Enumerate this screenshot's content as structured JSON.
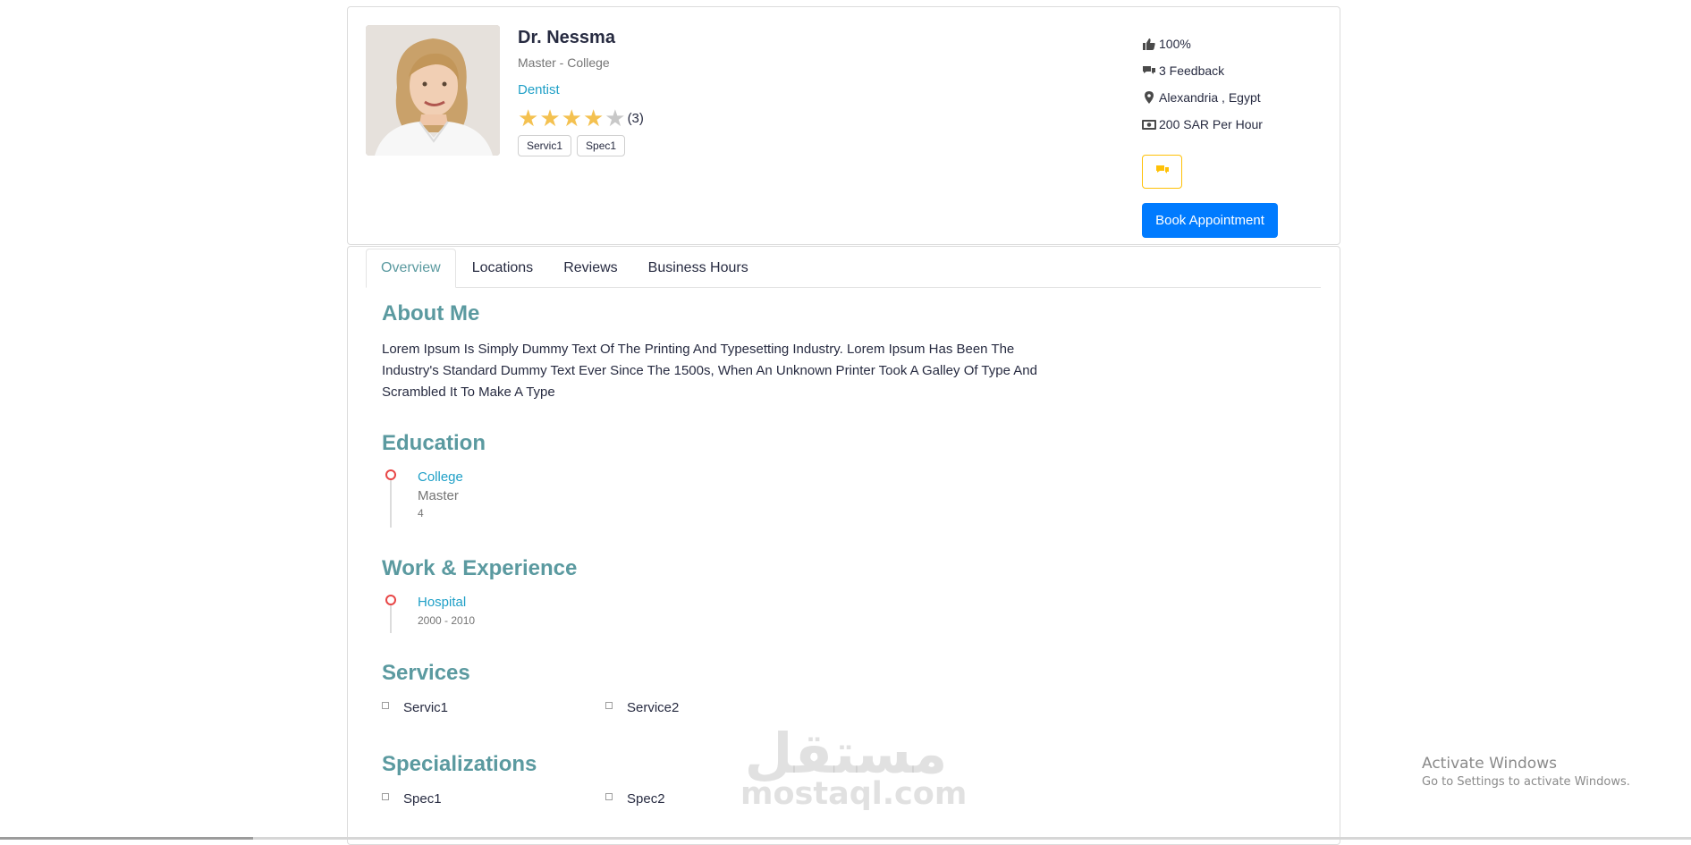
{
  "profile": {
    "name": "Dr. Nessma",
    "degree": "Master - College",
    "specialty": "Dentist",
    "rating": 4,
    "rating_max": 5,
    "rating_count": "(3)",
    "tags": [
      "Servic1",
      "Spec1"
    ]
  },
  "side": {
    "likes": "100%",
    "feedback": "3 Feedback",
    "location": "Alexandria , Egypt",
    "price": "200 SAR Per Hour",
    "book_label": "Book Appointment"
  },
  "tabs": [
    {
      "label": "Overview",
      "active": true
    },
    {
      "label": "Locations",
      "active": false
    },
    {
      "label": "Reviews",
      "active": false
    },
    {
      "label": "Business Hours",
      "active": false
    }
  ],
  "about": {
    "title": "About Me",
    "text": "Lorem Ipsum Is Simply Dummy Text Of The Printing And Typesetting Industry. Lorem Ipsum Has Been The Industry's Standard Dummy Text Ever Since The 1500s, When An Unknown Printer Took A Galley Of Type And Scrambled It To Make A Type"
  },
  "education": {
    "title": "Education",
    "items": [
      {
        "institution": "College",
        "degree": "Master",
        "years": "4"
      }
    ]
  },
  "experience": {
    "title": "Work & Experience",
    "items": [
      {
        "place": "Hospital",
        "period": "2000 - 2010"
      }
    ]
  },
  "services": {
    "title": "Services",
    "items": [
      "Servic1",
      "Service2"
    ]
  },
  "specializations": {
    "title": "Specializations",
    "items": [
      "Spec1",
      "Spec2"
    ]
  },
  "watermark": {
    "arabic": "مستقل",
    "latin": "mostaql.com"
  },
  "windows_notice": {
    "title": "Activate Windows",
    "subtitle": "Go to Settings to activate Windows."
  },
  "colors": {
    "accent": "#5b9aa0",
    "link": "#20a0c7",
    "primary_button": "#007bff",
    "star": "#f4c150",
    "chat_border": "#ffc107",
    "timeline_dot": "#e84646"
  }
}
